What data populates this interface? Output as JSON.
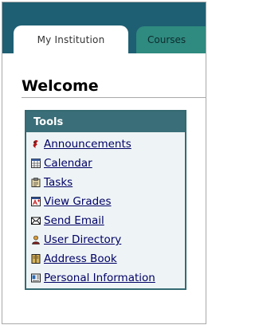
{
  "tabs": [
    {
      "label": "My Institution"
    },
    {
      "label": "Courses"
    }
  ],
  "welcome": {
    "title": "Welcome"
  },
  "tools": {
    "header": "Tools",
    "items": [
      {
        "label": "Announcements",
        "icon": "announcements-icon"
      },
      {
        "label": "Calendar",
        "icon": "calendar-icon"
      },
      {
        "label": "Tasks",
        "icon": "tasks-icon"
      },
      {
        "label": "View Grades",
        "icon": "grades-icon"
      },
      {
        "label": "Send Email",
        "icon": "email-icon"
      },
      {
        "label": "User Directory",
        "icon": "user-directory-icon"
      },
      {
        "label": "Address Book",
        "icon": "address-book-icon"
      },
      {
        "label": "Personal Information",
        "icon": "personal-info-icon"
      }
    ]
  },
  "colors": {
    "tab_bar": "#1e5f73",
    "inactive_tab": "#2f8a7f",
    "tools_header": "#3a6e78",
    "link": "#000066"
  }
}
